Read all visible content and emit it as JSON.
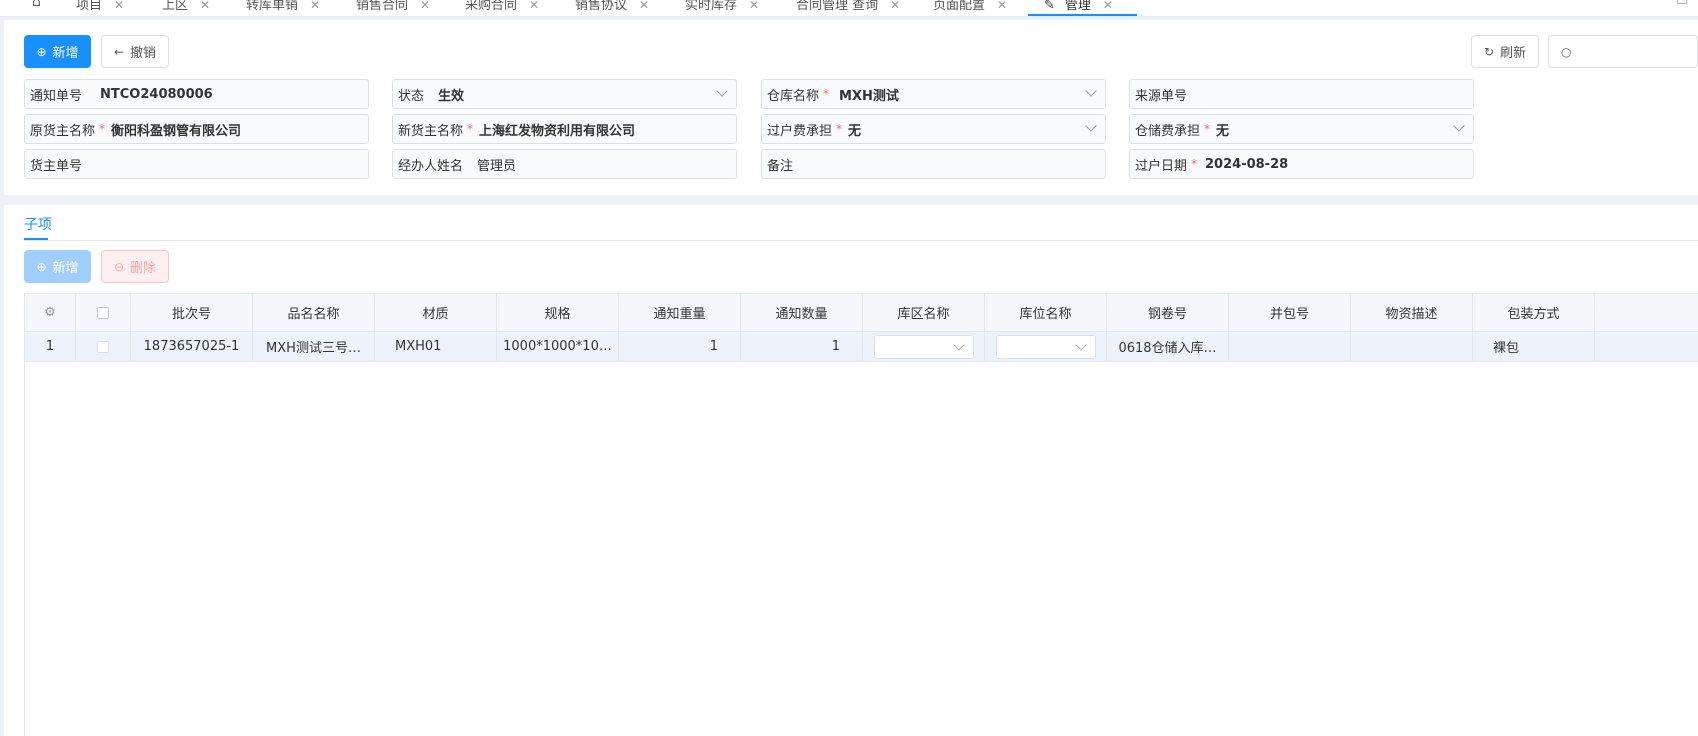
{
  "tabs": [
    {
      "label": "项目",
      "active": false
    },
    {
      "label": "上区",
      "active": false
    },
    {
      "label": "转库单销",
      "active": false
    },
    {
      "label": "销售合同",
      "active": false
    },
    {
      "label": "采购合同",
      "active": false
    },
    {
      "label": "销售协议",
      "active": false
    },
    {
      "label": "实时库存",
      "active": false
    },
    {
      "label": "合同管理 查询",
      "active": false
    },
    {
      "label": "页面配置",
      "active": false
    },
    {
      "label": "管理",
      "active": true
    }
  ],
  "toolbar": {
    "add_label": "新增",
    "undo_label": "撤销",
    "refresh_label": "刷新"
  },
  "form": {
    "notice_no": {
      "label": "通知单号",
      "value": "NTCO24080006"
    },
    "status": {
      "label": "状态",
      "value": "生效"
    },
    "warehouse": {
      "label": "仓库名称",
      "value": "MXH测试"
    },
    "source_no": {
      "label": "来源单号",
      "value": ""
    },
    "orig_owner": {
      "label": "原货主名称",
      "value": "衡阳科盈钢管有限公司"
    },
    "new_owner": {
      "label": "新货主名称",
      "value": "上海红发物资利用有限公司"
    },
    "transfer_fee": {
      "label": "过户费承担",
      "value": "无"
    },
    "storage_fee": {
      "label": "仓储费承担",
      "value": "无"
    },
    "owner_no": {
      "label": "货主单号",
      "value": ""
    },
    "handler": {
      "label": "经办人姓名",
      "value": "管理员"
    },
    "remark": {
      "label": "备注",
      "value": ""
    },
    "transfer_date": {
      "label": "过户日期",
      "value": "2024-08-28"
    }
  },
  "required_mark": "*",
  "subtab": {
    "label": "子项"
  },
  "sub_toolbar": {
    "add_label": "新增",
    "delete_label": "删除"
  },
  "table": {
    "columns": [
      "批次号",
      "品名名称",
      "材质",
      "规格",
      "通知重量",
      "通知数量",
      "库区名称",
      "库位名称",
      "钢卷号",
      "并包号",
      "物资描述",
      "包装方式"
    ],
    "rows": [
      {
        "index": "1",
        "batch": "1873657025-1",
        "product": "MXH测试三号…",
        "material": "MXH01",
        "spec": "1000*1000*10…",
        "weight": "1",
        "qty": "1",
        "area": "",
        "location": "",
        "coil": "0618仓储入库…",
        "bundle": "",
        "desc": "",
        "pack": "裸包"
      }
    ]
  },
  "colors": {
    "primary": "#1890ff",
    "required": "#f56c6c",
    "row_highlight": "#ecf3fd"
  }
}
